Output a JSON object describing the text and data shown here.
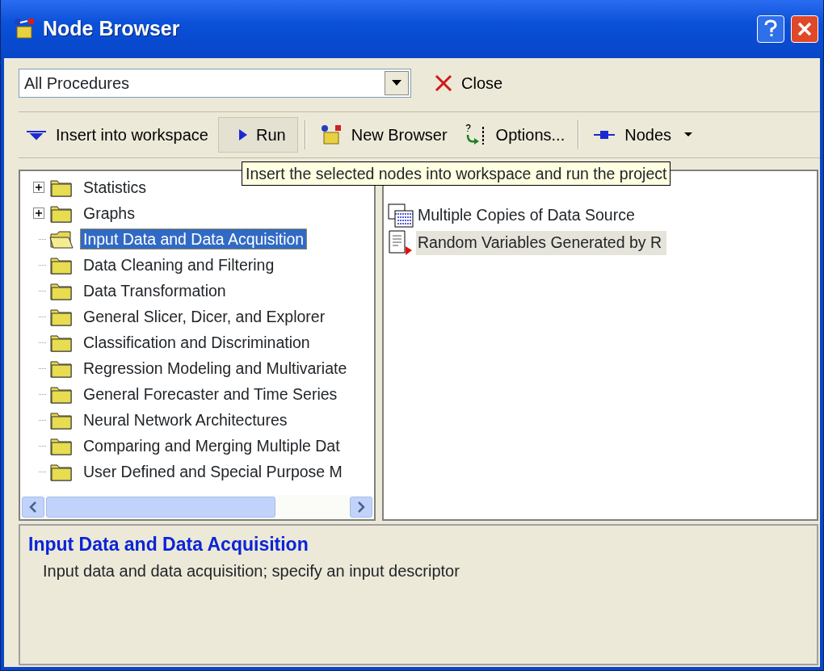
{
  "window": {
    "title": "Node Browser"
  },
  "filter": {
    "value": "All Procedures",
    "close_label": "Close"
  },
  "toolbar": [
    {
      "kind": "insert",
      "label": "Insert into workspace"
    },
    {
      "kind": "run",
      "label": "Run"
    },
    {
      "kind": "separator"
    },
    {
      "kind": "browser",
      "label": "New Browser"
    },
    {
      "kind": "options",
      "label": "Options..."
    },
    {
      "kind": "separator"
    },
    {
      "kind": "nodes",
      "label": "Nodes"
    }
  ],
  "tree": [
    {
      "label": "Statistics",
      "kind": "branch",
      "selected": false
    },
    {
      "label": "Graphs",
      "kind": "branch",
      "selected": false
    },
    {
      "label": "Input Data and Data Acquisition",
      "kind": "leaf",
      "selected": true
    },
    {
      "label": "Data Cleaning and Filtering",
      "kind": "leaf",
      "selected": false
    },
    {
      "label": "Data Transformation",
      "kind": "leaf",
      "selected": false
    },
    {
      "label": "General Slicer, Dicer, and Explorer",
      "kind": "leaf",
      "selected": false
    },
    {
      "label": "Classification and Discrimination",
      "kind": "leaf",
      "selected": false
    },
    {
      "label": "Regression Modeling and Multivariate",
      "kind": "leaf",
      "selected": false
    },
    {
      "label": "General Forecaster and Time Series",
      "kind": "leaf",
      "selected": false
    },
    {
      "label": "Neural Network Architectures",
      "kind": "leaf",
      "selected": false
    },
    {
      "label": "Comparing and Merging Multiple Dat",
      "kind": "leaf",
      "selected": false
    },
    {
      "label": "User Defined and Special Purpose M",
      "kind": "leaf",
      "selected": false
    }
  ],
  "nodes": [
    {
      "label": "Multiple Copies of Data Source",
      "kind": "table",
      "selected": false
    },
    {
      "label": "Random Variables Generated by R",
      "kind": "document",
      "selected": true
    }
  ],
  "tooltip": "Insert the selected nodes into workspace and run the project",
  "description": {
    "title": "Input Data and Data Acquisition",
    "text": "Input data and data acquisition; specify an input descriptor"
  }
}
